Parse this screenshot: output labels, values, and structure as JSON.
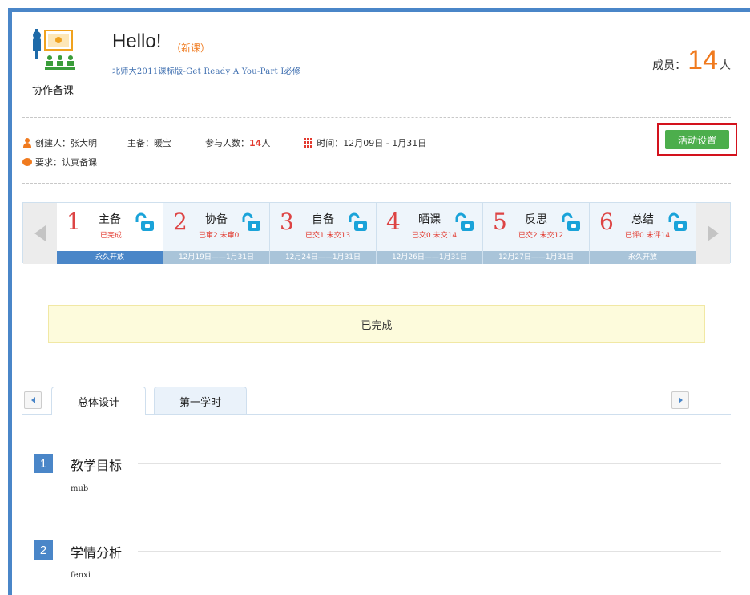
{
  "header": {
    "logo_label": "协作备课",
    "title": "Hello!",
    "tag": "（新课）",
    "subtitle": "北师大2011课标版-Get  Ready  A  You-Part  I必修",
    "members_label": "成员：",
    "members_count": "14",
    "members_unit": "人"
  },
  "info": {
    "creator": "创建人：张大明",
    "lead": "主备：暖宝",
    "participants_label": "参与人数：",
    "participants_count": "14",
    "participants_unit": "人",
    "time": "时间：12月09日 - 1月31日",
    "requirement": "要求：认真备课",
    "settings_button": "活动设置"
  },
  "steps": [
    {
      "num": "1",
      "name": "主备",
      "status": "已完成",
      "date": "永久开放",
      "active": true
    },
    {
      "num": "2",
      "name": "协备",
      "status": "已审2  未审0",
      "date": "12月19日——1月31日",
      "active": false
    },
    {
      "num": "3",
      "name": "自备",
      "status": "已交1  未交13",
      "date": "12月24日——1月31日",
      "active": false
    },
    {
      "num": "4",
      "name": "晒课",
      "status": "已交0  未交14",
      "date": "12月26日——1月31日",
      "active": false
    },
    {
      "num": "5",
      "name": "反思",
      "status": "已交2  未交12",
      "date": "12月27日——1月31日",
      "active": false
    },
    {
      "num": "6",
      "name": "总结",
      "status": "已评0  未评14",
      "date": "永久开放",
      "active": false
    }
  ],
  "notice": "已完成",
  "tabs": [
    {
      "label": "总体设计",
      "active": true
    },
    {
      "label": "第一学时",
      "active": false
    }
  ],
  "sections": [
    {
      "num": "1",
      "title": "教学目标",
      "body": "mub"
    },
    {
      "num": "2",
      "title": "学情分析",
      "body": "fenxi"
    }
  ],
  "colors": {
    "accent_blue": "#4a86c8",
    "orange": "#f07a1e",
    "red": "#e23a2f",
    "green_button": "#4cae4c",
    "highlight_border": "#d3121d"
  }
}
